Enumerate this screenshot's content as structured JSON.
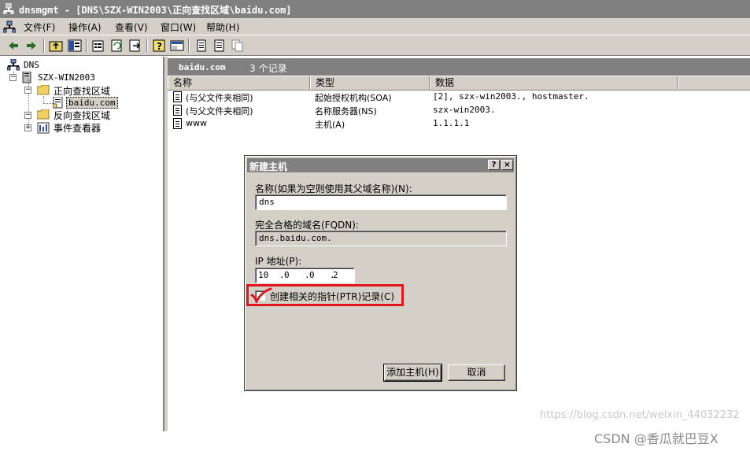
{
  "window": {
    "title": "dnsmgmt - [DNS\\SZX-WIN2003\\正向查找区域\\baidu.com]"
  },
  "menu": [
    "文件(F)",
    "操作(A)",
    "查看(V)",
    "窗口(W)",
    "帮助(H)"
  ],
  "toolbar": {
    "buttons": [
      "back-icon",
      "forward-icon",
      "up-folder-icon",
      "show-tree-icon",
      "properties-icon",
      "refresh-icon",
      "export-icon",
      "help-icon",
      "console-icon",
      "new-record-icon",
      "new-doc-icon",
      "copy-icon"
    ]
  },
  "tree": {
    "root": "DNS",
    "server": "SZX-WIN2003",
    "forward_zone": "正向查找区域",
    "zone": "baidu.com",
    "reverse_zone": "反向查找区域",
    "event_viewer": "事件查看器"
  },
  "pane": {
    "zone_name": "baidu.com",
    "record_count": "3 个记录",
    "columns": [
      "名称",
      "类型",
      "数据"
    ],
    "records": [
      {
        "name": "(与父文件夹相同)",
        "type": "起始授权机构(SOA)",
        "data": "[2], szx-win2003., hostmaster."
      },
      {
        "name": "(与父文件夹相同)",
        "type": "名称服务器(NS)",
        "data": "szx-win2003."
      },
      {
        "name": "www",
        "type": "主机(A)",
        "data": "1.1.1.1"
      }
    ]
  },
  "dialog": {
    "title": "新建主机",
    "help_btn": "?",
    "close_btn": "×",
    "name_label": "名称(如果为空则使用其父域名称)(N):",
    "name_value": "dns",
    "fqdn_label": "完全合格的域名(FQDN):",
    "fqdn_value": "dns.baidu.com.",
    "ip_label": "IP 地址(P):",
    "ip_octets": [
      "10",
      "0",
      "0",
      "2"
    ],
    "ptr_label": "创建相关的指针(PTR)记录(C)",
    "ptr_checked": true,
    "add_button": "添加主机(H)",
    "cancel_button": "取消"
  },
  "annotation": {
    "color": "#e3141b"
  },
  "watermark": {
    "url": "https://blog.csdn.net/weixin_44032232",
    "brand": "CSDN @香瓜就巴豆X"
  }
}
